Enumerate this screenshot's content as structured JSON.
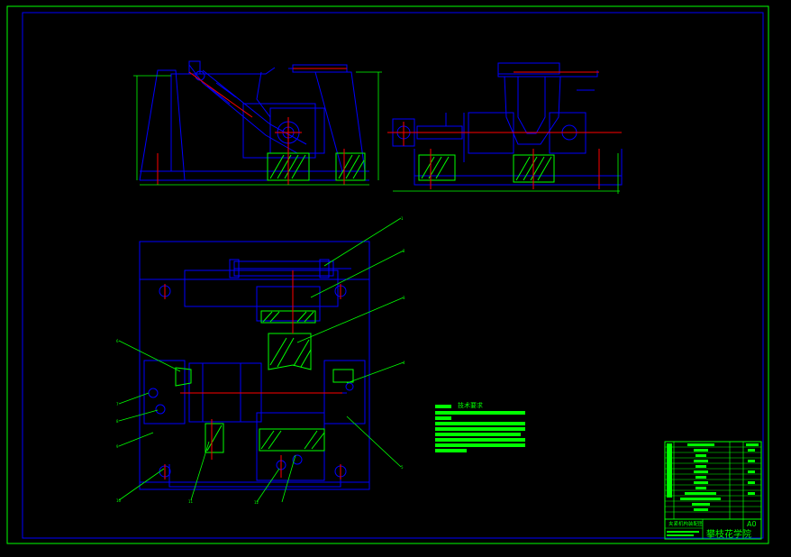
{
  "drawing": {
    "title_block": {
      "school": "攀枝花学院",
      "drawing_name": "夹紧机构装配图",
      "sheet_size": "A0"
    },
    "tech_requirements": {
      "heading": "技术要求"
    },
    "callouts": [
      "1",
      "2",
      "3",
      "4",
      "5",
      "6",
      "7",
      "8",
      "9",
      "10",
      "11",
      "12"
    ],
    "colors": {
      "frame": "#00ff00",
      "outline": "#0000ff",
      "center": "#ff0000",
      "fill": "#00ff00",
      "hatch": "#00ff00",
      "dim": "#00ff00",
      "background": "#000000"
    }
  }
}
